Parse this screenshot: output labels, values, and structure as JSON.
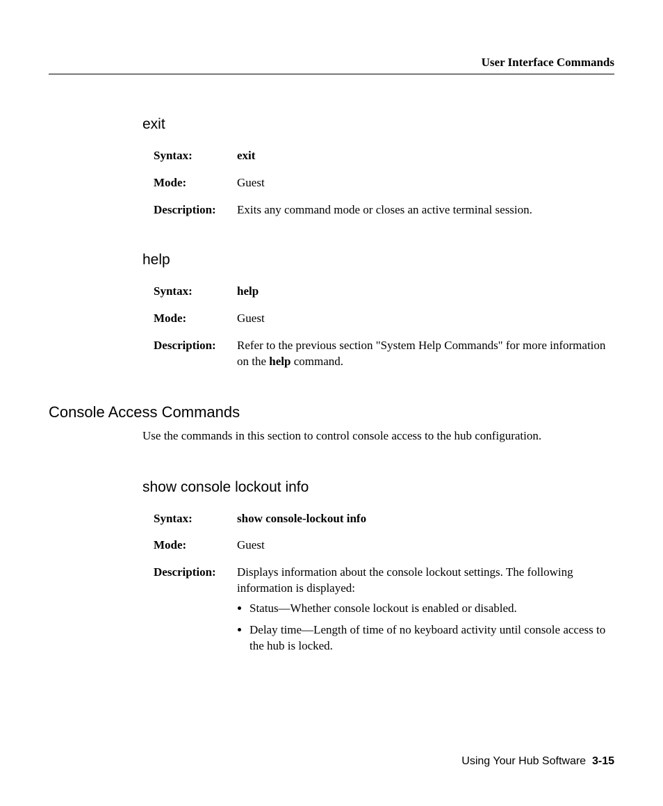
{
  "header": {
    "running_title": "User Interface Commands"
  },
  "labels": {
    "syntax": "Syntax:",
    "mode": "Mode:",
    "description": "Description:"
  },
  "commands": {
    "exit": {
      "title": "exit",
      "syntax": "exit",
      "mode": "Guest",
      "description": "Exits any command mode or closes an active terminal session."
    },
    "help": {
      "title": "help",
      "syntax": "help",
      "mode": "Guest",
      "description_pre": "Refer to the previous section \"System Help Commands\" for more information on the ",
      "description_bold": "help",
      "description_post": " command."
    },
    "show_console_lockout": {
      "title": "show console lockout info",
      "syntax": "show console-lockout info",
      "mode": "Guest",
      "description": "Displays information about the console lockout settings. The following information is displayed:",
      "bullets": [
        "Status—Whether console lockout is enabled or disabled.",
        "Delay time—Length of time of no keyboard activity until console access to the hub is locked."
      ]
    }
  },
  "section": {
    "title": "Console Access Commands",
    "intro": "Use the commands in this section to control console access to the hub configuration."
  },
  "footer": {
    "text": "Using Your Hub Software",
    "page": "3-15"
  }
}
